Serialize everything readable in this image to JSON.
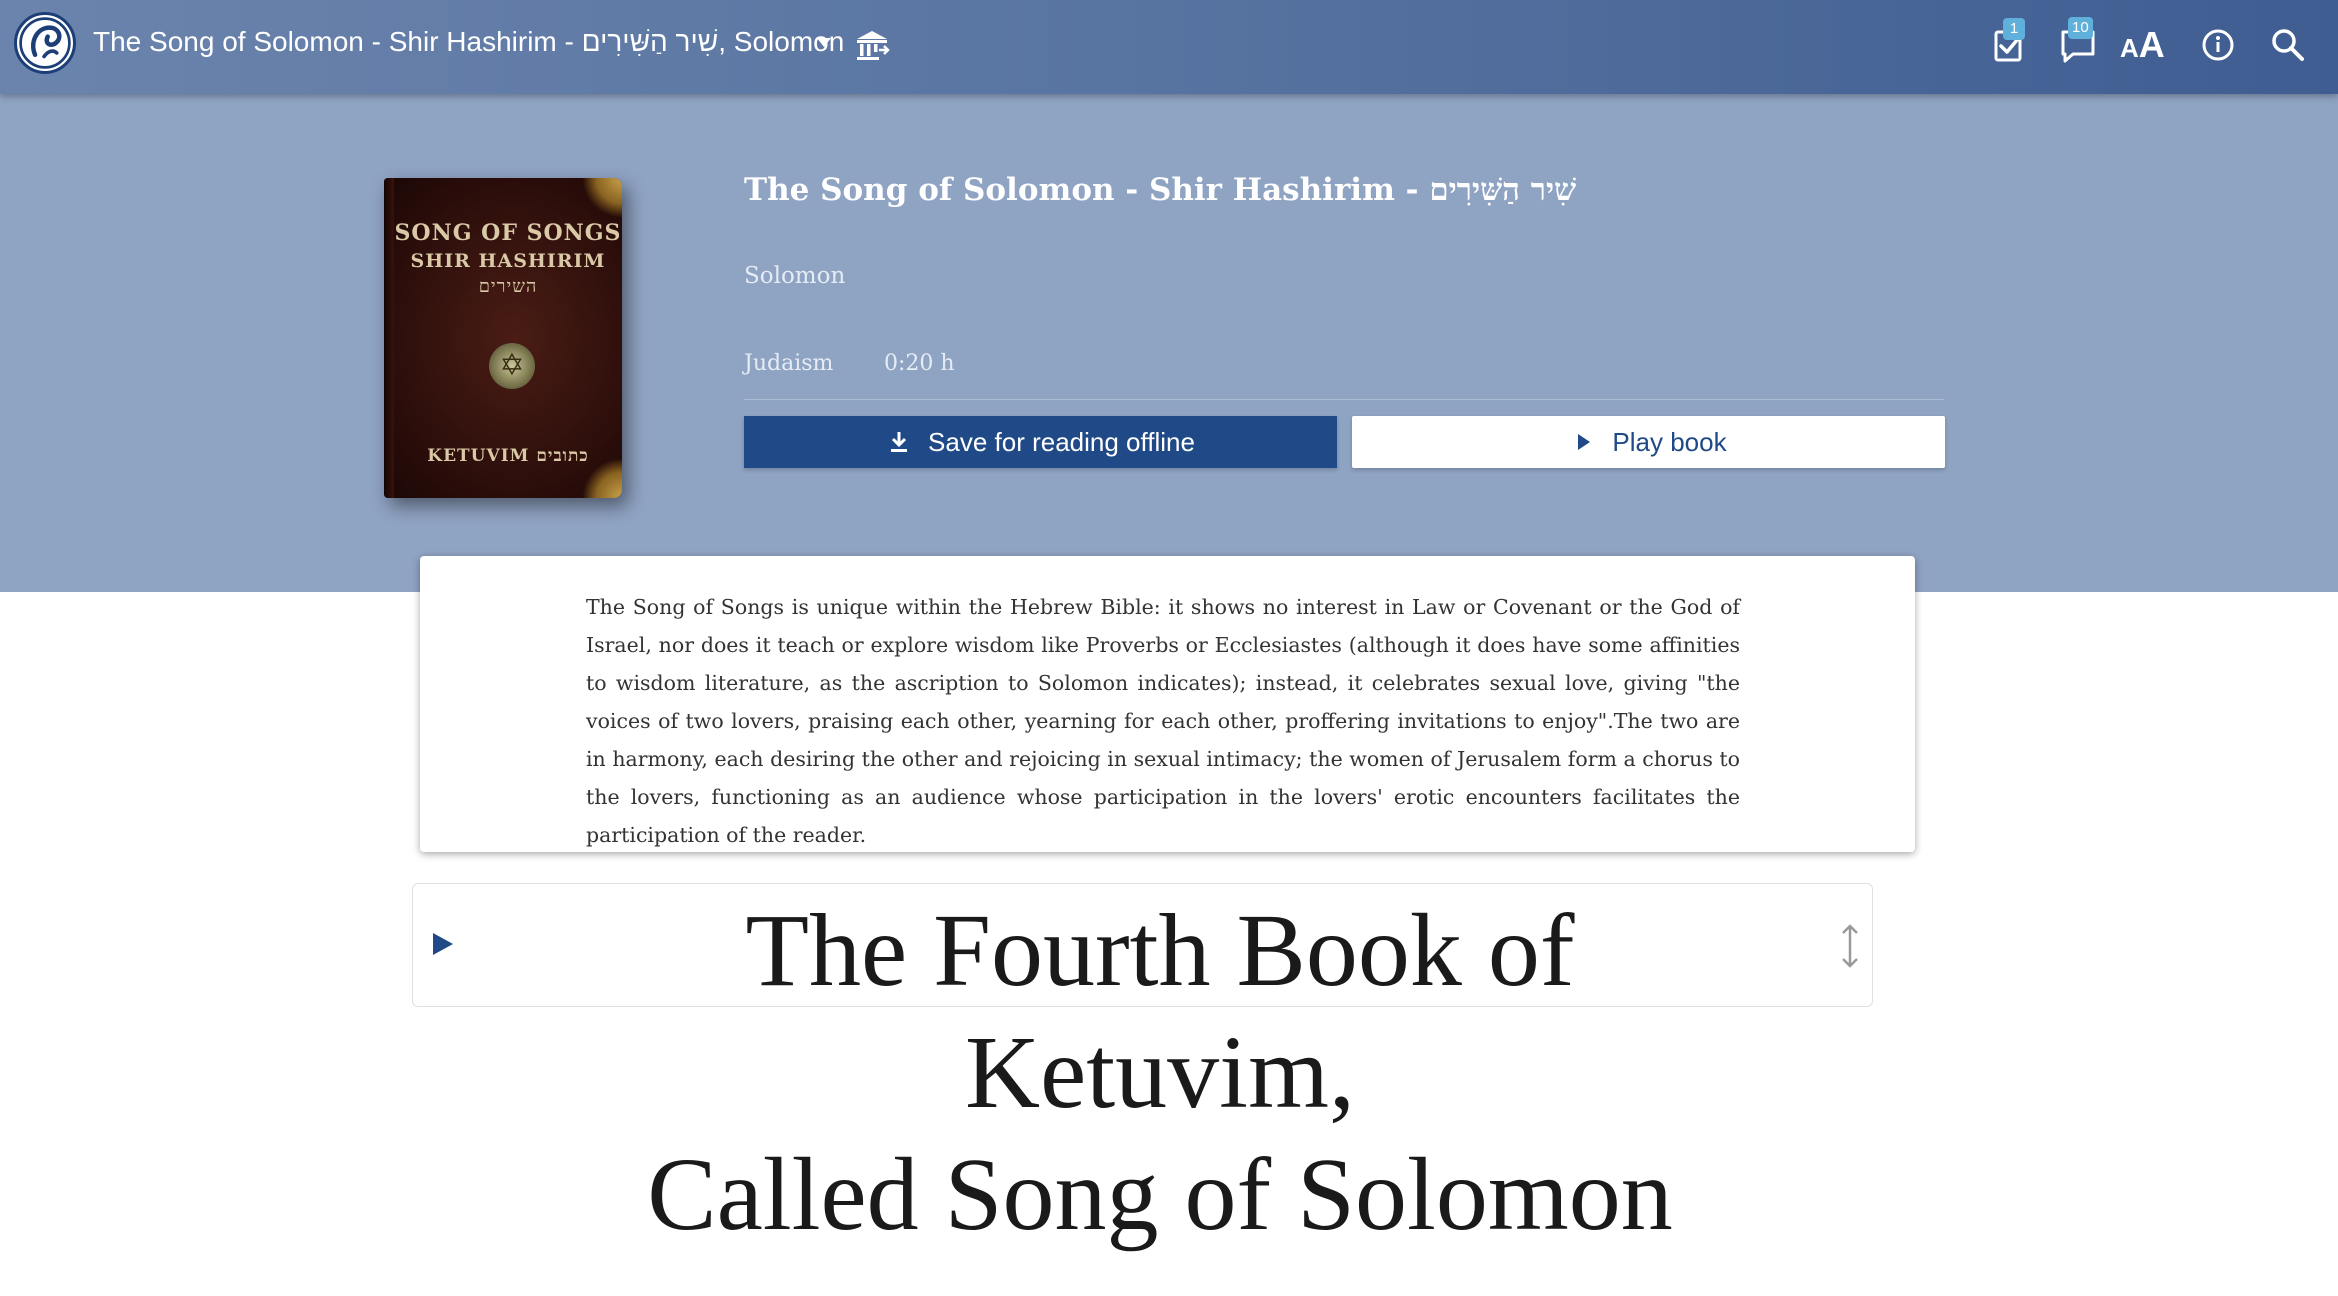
{
  "appbar": {
    "title": "The Song of Solomon - Shir Hashirim - שִׁיר הַשִּׁירִים, Solomon",
    "icons": [
      "logo-icon",
      "library-icon",
      "task-check-icon",
      "comments-icon",
      "font-size-icon",
      "info-icon",
      "search-icon"
    ],
    "tasks_badge": "1",
    "comments_badge": "10",
    "font_size_label_small": "A",
    "font_size_label_big": "A"
  },
  "book": {
    "title": "The Song of Solomon - Shir Hashirim - שִׁיר הַשִּׁירִים",
    "author": "Solomon",
    "category": "Judaism",
    "duration": "0:20 h",
    "cover": {
      "line1": "SONG OF SONGS",
      "line2": "SHIR HASHIRIM",
      "line3": "השירים",
      "footer": "KETUVIM כתובים"
    }
  },
  "actions": {
    "save_label": "Save for reading offline",
    "play_label": "Play book"
  },
  "description": "The Song of Songs is unique within the Hebrew Bible: it shows no interest in Law or Covenant or the God of Israel, nor does it teach or explore wisdom like Proverbs or Ecclesiastes (although it does have some affinities to wisdom literature, as the ascription to Solomon indicates); instead, it celebrates sexual love, giving \"the voices of two lovers, praising each other, yearning for each other, proffering invitations to enjoy\".The two are in harmony, each desiring the other and rejoicing in sexual intimacy; the women of Jerusalem form a chorus to the lovers, functioning as an audience whose participation in the lovers' erotic encounters facilitates the participation of the reader.",
  "chapter": {
    "title_line1": "The Fourth Book of",
    "title_line2": "Ketuvim,",
    "title_line3": "Called Song of Solomon"
  },
  "colors": {
    "appbar_start": "#6b84ad",
    "appbar_end": "#3f5d92",
    "header_band": "#8fa3c3",
    "primary": "#1f4a87",
    "badge": "#5fb1dc"
  }
}
